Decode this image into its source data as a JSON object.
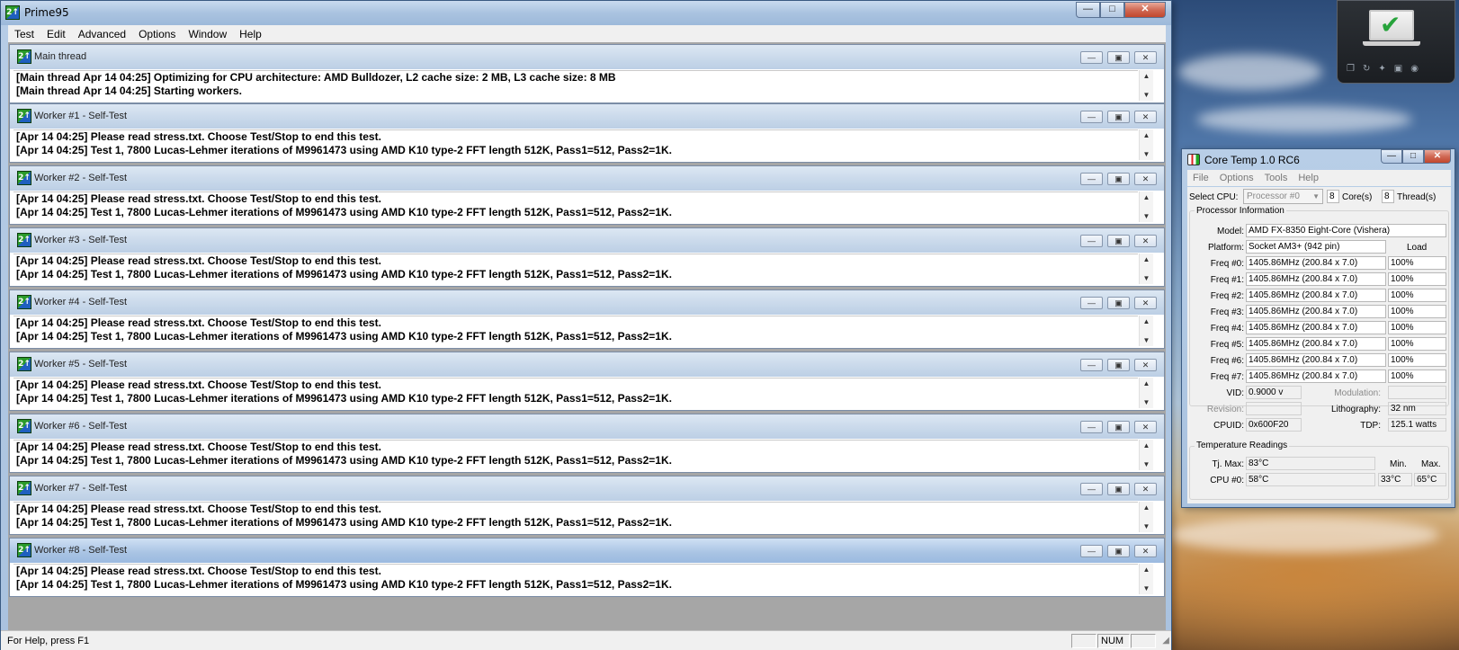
{
  "prime95": {
    "title": "Prime95",
    "app_icon_glyph": "2↑",
    "caption": {
      "min": "—",
      "max": "□",
      "close": "✕"
    },
    "menu": [
      "Test",
      "Edit",
      "Advanced",
      "Options",
      "Window",
      "Help"
    ],
    "main_thread": {
      "title": "Main thread",
      "lines": [
        "[Main thread Apr 14 04:25] Optimizing for CPU architecture: AMD Bulldozer, L2 cache size: 2 MB, L3 cache size: 8 MB",
        "[Main thread Apr 14 04:25] Starting workers."
      ]
    },
    "workers": [
      {
        "title": "Worker #1 - Self-Test",
        "lines": [
          "[Apr 14 04:25] Please read stress.txt.  Choose Test/Stop to end this test.",
          "[Apr 14 04:25] Test 1, 7800 Lucas-Lehmer iterations of M9961473 using AMD K10 type-2 FFT length 512K, Pass1=512, Pass2=1K."
        ]
      },
      {
        "title": "Worker #2 - Self-Test",
        "lines": [
          "[Apr 14 04:25] Please read stress.txt.  Choose Test/Stop to end this test.",
          "[Apr 14 04:25] Test 1, 7800 Lucas-Lehmer iterations of M9961473 using AMD K10 type-2 FFT length 512K, Pass1=512, Pass2=1K."
        ]
      },
      {
        "title": "Worker #3 - Self-Test",
        "lines": [
          "[Apr 14 04:25] Please read stress.txt.  Choose Test/Stop to end this test.",
          "[Apr 14 04:25] Test 1, 7800 Lucas-Lehmer iterations of M9961473 using AMD K10 type-2 FFT length 512K, Pass1=512, Pass2=1K."
        ]
      },
      {
        "title": "Worker #4 - Self-Test",
        "lines": [
          "[Apr 14 04:25] Please read stress.txt.  Choose Test/Stop to end this test.",
          "[Apr 14 04:25] Test 1, 7800 Lucas-Lehmer iterations of M9961473 using AMD K10 type-2 FFT length 512K, Pass1=512, Pass2=1K."
        ]
      },
      {
        "title": "Worker #5 - Self-Test",
        "lines": [
          "[Apr 14 04:25] Please read stress.txt.  Choose Test/Stop to end this test.",
          "[Apr 14 04:25] Test 1, 7800 Lucas-Lehmer iterations of M9961473 using AMD K10 type-2 FFT length 512K, Pass1=512, Pass2=1K."
        ]
      },
      {
        "title": "Worker #6 - Self-Test",
        "lines": [
          "[Apr 14 04:25] Please read stress.txt.  Choose Test/Stop to end this test.",
          "[Apr 14 04:25] Test 1, 7800 Lucas-Lehmer iterations of M9961473 using AMD K10 type-2 FFT length 512K, Pass1=512, Pass2=1K."
        ]
      },
      {
        "title": "Worker #7 - Self-Test",
        "lines": [
          "[Apr 14 04:25] Please read stress.txt.  Choose Test/Stop to end this test.",
          "[Apr 14 04:25] Test 1, 7800 Lucas-Lehmer iterations of M9961473 using AMD K10 type-2 FFT length 512K, Pass1=512, Pass2=1K."
        ]
      },
      {
        "title": "Worker #8 - Self-Test",
        "lines": [
          "[Apr 14 04:25] Please read stress.txt.  Choose Test/Stop to end this test.",
          "[Apr 14 04:25] Test 1, 7800 Lucas-Lehmer iterations of M9961473 using AMD K10 type-2 FFT length 512K, Pass1=512, Pass2=1K."
        ]
      }
    ],
    "status": {
      "help_text": "For Help, press F1",
      "num": "NUM"
    }
  },
  "gadget": {
    "icons": [
      "restore-icon",
      "refresh-icon",
      "twitter-icon",
      "facebook-icon",
      "rss-icon"
    ]
  },
  "coretemp": {
    "title": "Core Temp 1.0 RC6",
    "menu": [
      "File",
      "Options",
      "Tools",
      "Help"
    ],
    "select_cpu_label": "Select CPU:",
    "processor": "Processor #0",
    "cores_value": "8",
    "cores_label": "Core(s)",
    "threads_value": "8",
    "threads_label": "Thread(s)",
    "proc_info_title": "Processor Information",
    "model_label": "Model:",
    "model": "AMD FX-8350 Eight-Core (Vishera)",
    "platform_label": "Platform:",
    "platform": "Socket AM3+ (942 pin)",
    "load_label": "Load",
    "freqs": [
      {
        "label": "Freq #0:",
        "value": "1405.86MHz (200.84 x 7.0)",
        "load": "100%"
      },
      {
        "label": "Freq #1:",
        "value": "1405.86MHz (200.84 x 7.0)",
        "load": "100%"
      },
      {
        "label": "Freq #2:",
        "value": "1405.86MHz (200.84 x 7.0)",
        "load": "100%"
      },
      {
        "label": "Freq #3:",
        "value": "1405.86MHz (200.84 x 7.0)",
        "load": "100%"
      },
      {
        "label": "Freq #4:",
        "value": "1405.86MHz (200.84 x 7.0)",
        "load": "100%"
      },
      {
        "label": "Freq #5:",
        "value": "1405.86MHz (200.84 x 7.0)",
        "load": "100%"
      },
      {
        "label": "Freq #6:",
        "value": "1405.86MHz (200.84 x 7.0)",
        "load": "100%"
      },
      {
        "label": "Freq #7:",
        "value": "1405.86MHz (200.84 x 7.0)",
        "load": "100%"
      }
    ],
    "vid_label": "VID:",
    "vid": "0.9000 v",
    "modulation_label": "Modulation:",
    "revision_label": "Revision:",
    "lithography_label": "Lithography:",
    "lithography": "32 nm",
    "cpuid_label": "CPUID:",
    "cpuid": "0x600F20",
    "tdp_label": "TDP:",
    "tdp": "125.1 watts",
    "temp_title": "Temperature Readings",
    "tjmax_label": "Tj. Max:",
    "tjmax": "83°C",
    "min_label": "Min.",
    "max_label": "Max.",
    "cpu0_label": "CPU #0:",
    "cpu0": "58°C",
    "cpu0_min": "33°C",
    "cpu0_max": "65°C"
  }
}
